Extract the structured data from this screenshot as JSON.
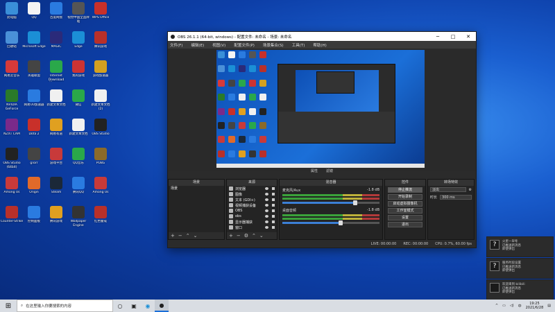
{
  "desktop": {
    "icons": [
      {
        "label": "此电脑",
        "icon": "computer-icon",
        "color": "#3a8fd8"
      },
      {
        "label": "QQ",
        "icon": "qq-icon",
        "color": "#f4f4f4"
      },
      {
        "label": "百度网盘",
        "icon": "cloud-icon",
        "color": "#2a7be0"
      },
      {
        "label": "视觉中国全品牌站",
        "icon": "game-icon",
        "color": "#555"
      },
      {
        "label": "WPS Office",
        "icon": "wps-icon",
        "color": "#c8302a"
      },
      {
        "label": "回收站",
        "icon": "recycle-bin-icon",
        "color": "#4a90d8"
      },
      {
        "label": "Microsoft Edge",
        "icon": "edge-icon",
        "color": "#1b8fd6"
      },
      {
        "label": "MAGIC",
        "icon": "magic-icon",
        "color": "#2a2a7a"
      },
      {
        "label": "Edge",
        "icon": "edge-icon",
        "color": "#1b8fd6"
      },
      {
        "label": "腾讯游戏",
        "icon": "game-icon",
        "color": "#b8302a"
      },
      {
        "label": "网易云音乐",
        "icon": "music-icon",
        "color": "#d63a3a"
      },
      {
        "label": "英雄联盟",
        "icon": "game-icon",
        "color": "#444"
      },
      {
        "label": "Internet Download Manager",
        "icon": "download-icon",
        "color": "#2aa84a"
      },
      {
        "label": "我的游戏",
        "icon": "game-icon",
        "color": "#cc3333"
      },
      {
        "label": "游戏加速器",
        "icon": "game-icon",
        "color": "#d4a020"
      },
      {
        "label": "NVIDIA GeForce",
        "icon": "nvidia-icon",
        "color": "#2a7a2a"
      },
      {
        "label": "网易UU加速器",
        "icon": "game-icon",
        "color": "#2a7be0"
      },
      {
        "label": "新建文本文档",
        "icon": "file-icon",
        "color": "#f0f0f0"
      },
      {
        "label": "微信",
        "icon": "wechat-icon",
        "color": "#2aa84a"
      },
      {
        "label": "新建文本文档 (2)",
        "icon": "file-icon",
        "color": "#f0f0f0"
      },
      {
        "label": "NZXT CAM",
        "icon": "nzxt-icon",
        "color": "#7a2a8a"
      },
      {
        "label": "Dota 2",
        "icon": "game-icon",
        "color": "#c8302a"
      },
      {
        "label": "网易有道",
        "icon": "game-icon",
        "color": "#e0a020"
      },
      {
        "label": "新建文本文档",
        "icon": "file-icon",
        "color": "#f0f0f0"
      },
      {
        "label": "OBS Studio",
        "icon": "obs-icon",
        "color": "#222"
      },
      {
        "label": "OBS Studio (64bit)",
        "icon": "obs-icon",
        "color": "#222"
      },
      {
        "label": "gTorr",
        "icon": "game-icon",
        "color": "#444"
      },
      {
        "label": "游戏平台",
        "icon": "game-icon",
        "color": "#c83a3a"
      },
      {
        "label": "QQ音乐",
        "icon": "music-icon",
        "color": "#2aa84a"
      },
      {
        "label": "PUBG",
        "icon": "game-icon",
        "color": "#8a6a2a"
      },
      {
        "label": "Among Us",
        "icon": "game-icon",
        "color": "#c83a3a"
      },
      {
        "label": "Origin",
        "icon": "origin-icon",
        "color": "#e06a2a"
      },
      {
        "label": "Steam",
        "icon": "steam-icon",
        "color": "#1b2838"
      },
      {
        "label": "腾讯QQ",
        "icon": "qq-icon",
        "color": "#2a7be0"
      },
      {
        "label": "Among Us",
        "icon": "game-icon",
        "color": "#c83a3a"
      },
      {
        "label": "Counter-Strike",
        "icon": "game-icon",
        "color": "#b8302a"
      },
      {
        "label": "控制面板",
        "icon": "settings-icon",
        "color": "#2a7be0"
      },
      {
        "label": "腾讯游戏",
        "icon": "game-icon",
        "color": "#e0a020"
      },
      {
        "label": "Wallpaper Engine",
        "icon": "game-icon",
        "color": "#333"
      },
      {
        "label": "红色警戒",
        "icon": "game-icon",
        "color": "#b8302a"
      }
    ]
  },
  "obs": {
    "title": "OBS 26.1.1 (64-bit, windows) - 配置文件: 未命名 - 场景: 未命名",
    "menu": [
      "文件(F)",
      "编辑(E)",
      "视图(V)",
      "配置文件(P)",
      "场景集合(S)",
      "工具(T)",
      "帮助(H)"
    ],
    "preview_toolbar": [
      "属性",
      "滤镜"
    ],
    "docks": {
      "scenes": {
        "title": "场景",
        "items": [
          "场景"
        ]
      },
      "sources": {
        "title": "来源",
        "items": [
          "浏览器",
          "图像",
          "文本 (GDI+)",
          "视频捕获设备",
          "OBS",
          "obs",
          "显示器捕获",
          "窗口"
        ]
      },
      "mixer": {
        "title": "混音器",
        "channels": [
          {
            "name": "麦克风/Aux",
            "db": "-1.8 dB",
            "level": 0.75
          },
          {
            "name": "桌面音频",
            "db": "-1.8 dB",
            "level": 0.6
          }
        ]
      },
      "controls": {
        "title": "控件",
        "buttons": [
          "停止推流",
          "开始录制",
          "启动虚拟摄像机",
          "工作室模式",
          "设置",
          "退出"
        ]
      },
      "transitions": {
        "title": "转场特效",
        "type": "淡出",
        "duration_label": "时长",
        "duration": "300 ms"
      }
    },
    "status": [
      "LIVE: 00:00:00",
      "REC: 00:00:00",
      "CPU: 0.7%, 60.00 fps"
    ]
  },
  "notifications": [
    {
      "icon": "?",
      "line1": "火星一早冬",
      "line2": "已推送新消息",
      "line3": "即使弹出"
    },
    {
      "icon": "?",
      "line1": "服务时段设置",
      "line2": "已推送新消息",
      "line3": "即使弹出"
    },
    {
      "icon": "img",
      "line1": "欢迎来到 bilibili",
      "line2": "已推送新消息",
      "line3": "即使弹出"
    }
  ],
  "taskbar": {
    "search_placeholder": "在这里输入你要搜索的内容",
    "time": "19:25",
    "date": "2021/6/28"
  },
  "colors": {
    "accent": "#1b6fd8",
    "obs_bg": "#2b2b2b",
    "taskbar": "#d9dde3"
  }
}
